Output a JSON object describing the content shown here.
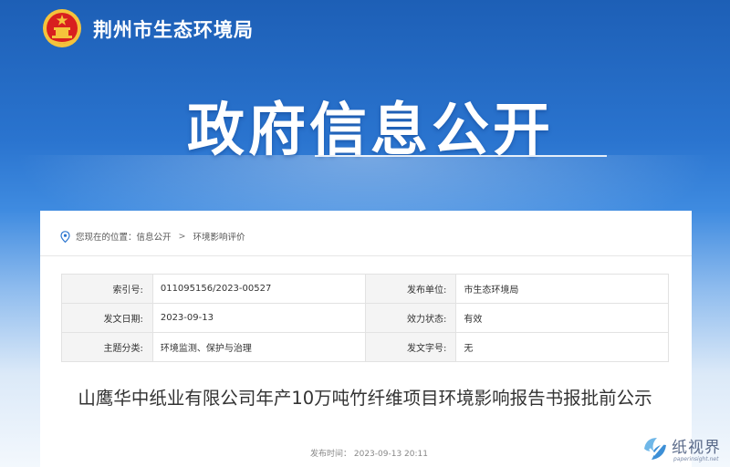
{
  "header": {
    "site_name": "荆州市生态环境局",
    "hero_title": "政府信息公开"
  },
  "breadcrumb": {
    "prefix": "您现在的位置：",
    "level1": "信息公开",
    "separator": ">",
    "level2": "环境影响评价"
  },
  "meta_table": {
    "rows": [
      {
        "k1": "索引号:",
        "v1": "011095156/2023-00527",
        "k2": "发布单位:",
        "v2": "市生态环境局"
      },
      {
        "k1": "发文日期:",
        "v1": "2023-09-13",
        "k2": "效力状态:",
        "v2": "有效"
      },
      {
        "k1": "主题分类:",
        "v1": "环境监测、保护与治理",
        "k2": "发文字号:",
        "v2": "无"
      }
    ]
  },
  "article": {
    "title": "山鹰华中纸业有限公司年产10万吨竹纤维项目环境影响报告书报批前公示",
    "pub_time": "发布时间：  2023-09-13 20:11"
  },
  "watermark": {
    "text": "纸视界",
    "url": "paperinsight.net"
  },
  "colors": {
    "banner_top": "#1d5fb6",
    "emblem_red": "#d8201f",
    "emblem_gold": "#f5c33b"
  }
}
